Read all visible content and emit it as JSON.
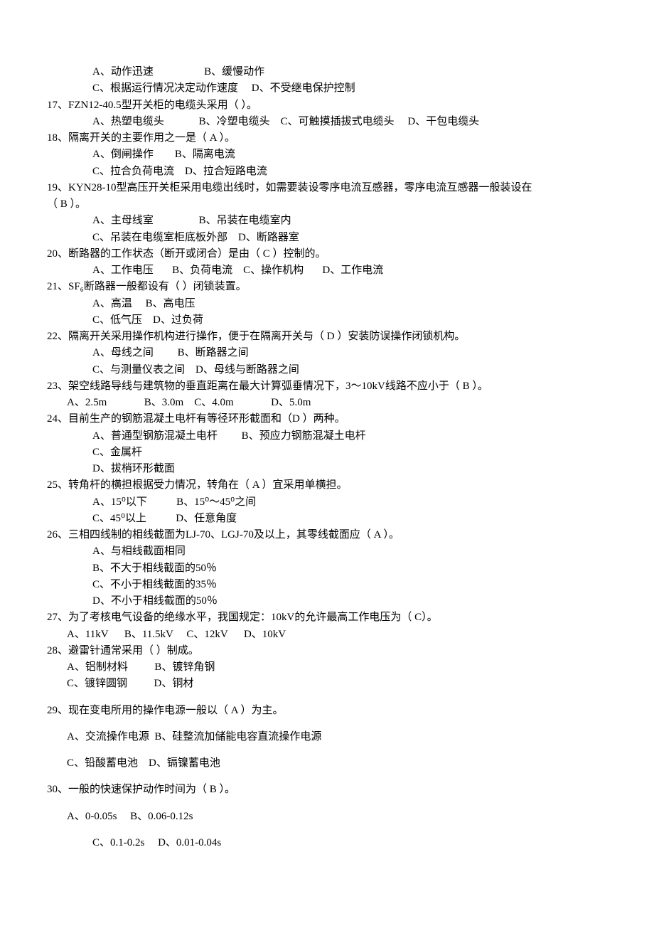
{
  "q16": {
    "optA": "A、动作迅速",
    "optB": "B、缓慢动作",
    "optC": "C、根据运行情况决定动作速度",
    "optD": "D、不受继电保护控制"
  },
  "q17": {
    "stem": "17、FZN12-40.5型开关柜的电缆头采用（    ）。",
    "optA": "A、热塑电缆头",
    "optB": "B、冷塑电缆头",
    "optC": "C、可触摸插拔式电缆头",
    "optD": "D、干包电缆头"
  },
  "q18": {
    "stem": "18、隔离开关的主要作用之一是（ A   ）。",
    "optA": "A、倒闸操作",
    "optB": "B、隔离电流",
    "optC": "C、拉合负荷电流",
    "optD": "D、拉合短路电流"
  },
  "q19": {
    "stem1": "19、KYN28-10型高压开关柜采用电缆出线时，如需要装设零序电流互感器，零序电流互感器一般装设在",
    "stem2": "（  B  ）。",
    "optA": "A、主母线室",
    "optB": "B、吊装在电缆室内",
    "optC": "C、吊装在电缆室柜底板外部",
    "optD": "D、断路器室"
  },
  "q20": {
    "stem": "20、断路器的工作状态（断开或闭合）是由（ C   ）控制的。",
    "optA": "A、工作电压",
    "optB": "B、负荷电流",
    "optC": "C、操作机构",
    "optD": "D、工作电流"
  },
  "q21": {
    "stem": "21、SF₆断路器一般都设有（    ）闭锁装置。",
    "optA": "A、高温",
    "optB": "B、高电压",
    "optC": "C、低气压",
    "optD": "D、过负荷"
  },
  "q22": {
    "stem": "22、隔离开关采用操作机构进行操作，便于在隔离开关与（ D   ）安装防误操作闭锁机构。",
    "optA": "A、母线之间",
    "optB": "B、断路器之间",
    "optC": "C、与测量仪表之间",
    "optD": "D、母线与断路器之间"
  },
  "q23": {
    "stem": "23、架空线路导线与建筑物的垂直距离在最大计算弧垂情况下，3～10kV线路不应小于（ B  ）。",
    "optA": "A、2.5m",
    "optB": "B、3.0m",
    "optC": "C、4.0m",
    "optD": "D、5.0m"
  },
  "q24": {
    "stem": "24、目前生产的钢筋混凝土电杆有等径环形截面和（D   ）两种。",
    "optA": "A、普通型钢筋混凝土电杆",
    "optB": "B、预应力钢筋混凝土电杆",
    "optC": "C、金属杆",
    "optD": "D、拔梢环形截面"
  },
  "q25": {
    "stem": "25、转角杆的横担根据受力情况，转角在（ A  ）宜采用单横担。",
    "optA": "A、15⁰以下",
    "optB": "B、15⁰～45⁰之间",
    "optC": "C、45⁰以上",
    "optD": "D、任意角度"
  },
  "q26": {
    "stem": "26、三相四线制的相线截面为LJ-70、LGJ-70及以上，其零线截面应（ A  ）。",
    "optA": "A、与相线截面相同",
    "optB": "B、不大于相线截面的50％",
    "optC": "C、不小于相线截面的35％",
    "optD": "D、不小于相线截面的50％"
  },
  "q27": {
    "stem": "27、为了考核电气设备的绝缘水平，我国规定：10kV的允许最高工作电压为（ C）。",
    "optA": "A、11kV",
    "optB": "B、11.5kV",
    "optC": "C、12kV",
    "optD": "D、10kV"
  },
  "q28": {
    "stem": "28、避雷针通常采用（   ）制成。",
    "optA": "A、铝制材料",
    "optB": "B、镀锌角钢",
    "optC": "C、镀锌圆钢",
    "optD": "D、铜材"
  },
  "q29": {
    "stem": "29、现在变电所用的操作电源一般以（ A ）为主。",
    "optA": "A、交流操作电源",
    "optB": "B、硅整流加储能电容直流操作电源",
    "optC": "C、铅酸蓄电池",
    "optD": "D、镉镍蓄电池"
  },
  "q30": {
    "stem": "30、一般的快速保护动作时间为（ B ）。",
    "optA": "A、0-0.05s",
    "optB": "B、0.06-0.12s",
    "optC": "C、0.1-0.2s",
    "optD": "D、0.01-0.04s"
  }
}
